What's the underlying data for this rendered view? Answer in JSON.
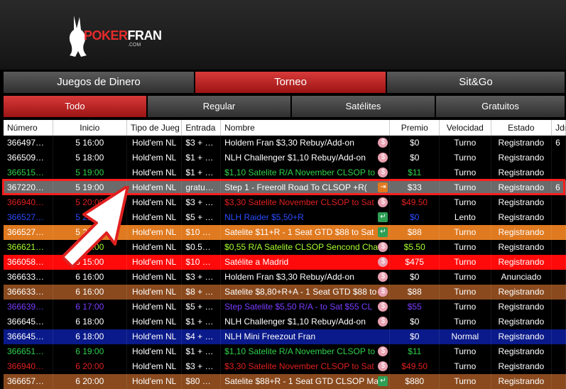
{
  "logo": {
    "text_poker": "POKER",
    "text_fran": "FRAN",
    "text_sub": ".COM"
  },
  "top_tabs": [
    {
      "label": "Juegos de Dinero",
      "active": false
    },
    {
      "label": "Torneo",
      "active": true
    },
    {
      "label": "Sit&Go",
      "active": false
    }
  ],
  "sub_tabs": [
    {
      "label": "Todo",
      "active": true
    },
    {
      "label": "Regular",
      "active": false
    },
    {
      "label": "Satélites",
      "active": false
    },
    {
      "label": "Gratuitos",
      "active": false
    }
  ],
  "columns": [
    "Número",
    "Inicio",
    "Tipo de Jueg",
    "Entrada",
    "Nombre",
    "Premio",
    "Velocidad",
    "Estado",
    "Jdr"
  ],
  "rows": [
    {
      "num": "366497…",
      "start": "5 16:00",
      "type": "Hold'em NL",
      "entry": "$3 + …",
      "name": "Holdem Fran $3,30 Rebuy/Add-on",
      "prize": "$0",
      "speed": "Turno",
      "status": "Registrando",
      "icon": "dollar-icon",
      "bg": "#000000",
      "fg": "#ffffff"
    },
    {
      "num": "366509…",
      "start": "5 18:00",
      "type": "Hold'em NL",
      "entry": "$1 + …",
      "name": "NLH Challenger $1,10 Rebuy/Add-on",
      "prize": "$0",
      "speed": "Turno",
      "status": "Registrando",
      "icon": "dollar-icon",
      "bg": "#000000",
      "fg": "#ffffff"
    },
    {
      "num": "366515…",
      "start": "5 19:00",
      "type": "Hold'em NL",
      "entry": "$1 + …",
      "name": "$1,10 Satelite R/A November CLSOP to",
      "prize": "$11",
      "speed": "Turno",
      "status": "Registrando",
      "icon": "dollar-icon",
      "bg": "#000000",
      "fg": "#2fd04a"
    },
    {
      "num": "367220…",
      "start": "5 19:00",
      "type": "Hold'em NL",
      "entry": "gratu…",
      "name": "Step 1 - Freeroll Road To CLSOP +R(",
      "prize": "$33",
      "speed": "Turno",
      "status": "Registrando",
      "icon": "enter-icon",
      "bg": "#6b6b6b",
      "fg": "#ffffff",
      "selected": true
    },
    {
      "num": "366940…",
      "start": "5 20:00",
      "type": "Hold'em NL",
      "entry": "$3 + …",
      "name": "$3,30 Satelite November CLSOP to Sat",
      "prize": "$49.50",
      "speed": "Turno",
      "status": "Registrando",
      "icon": "dollar-icon",
      "bg": "#000000",
      "fg": "#e02020"
    },
    {
      "num": "366527…",
      "start": "5 21:00",
      "type": "Hold'em NL",
      "entry": "$5 + …",
      "name": "NLH Raider $5,50+R",
      "prize": "$0",
      "speed": "Lento",
      "status": "Registrando",
      "icon": "return-icon",
      "bg": "#000000",
      "fg": "#2a4cff"
    },
    {
      "num": "366527…",
      "start": "5 21:00",
      "type": "Hold'em NL",
      "entry": "$10 …",
      "name": "Satelite $11+R - 1 Seat GTD $88  to Sat",
      "prize": "$88",
      "speed": "Turno",
      "status": "Registrando",
      "icon": "return-icon",
      "bg": "#e07a20",
      "fg": "#ffffff"
    },
    {
      "num": "366621…",
      "start": "5 22:00",
      "type": "Hold'em NL",
      "entry": "$0.5…",
      "name": "$0,55 R/A Satelite CLSOP Sencond Cha",
      "prize": "$5.50",
      "speed": "Turno",
      "status": "Registrando",
      "icon": "dollar-icon",
      "bg": "#000000",
      "fg": "#a8ff30"
    },
    {
      "num": "366058…",
      "start": "6 15:00",
      "type": "Hold'em NL",
      "entry": "$10 …",
      "name": "Satélite a Madrid",
      "prize": "$475",
      "speed": "Turno",
      "status": "Registrando",
      "icon": "dollar-icon",
      "bg": "#ff0a0a",
      "fg": "#ffffff"
    },
    {
      "num": "366633…",
      "start": "6 16:00",
      "type": "Hold'em NL",
      "entry": "$3 + …",
      "name": "Holdem Fran $3,30 Rebuy/Add-on",
      "prize": "$0",
      "speed": "Turno",
      "status": "Anunciado",
      "icon": "dollar-icon",
      "bg": "#000000",
      "fg": "#ffffff"
    },
    {
      "num": "366633…",
      "start": "6 16:00",
      "type": "Hold'em NL",
      "entry": "$8 + …",
      "name": "Satelite $8,80+R+A - 1 Seat GTD $88  to",
      "prize": "$88",
      "speed": "Turno",
      "status": "Registrando",
      "icon": "dollar-icon",
      "bg": "#8a4a1e",
      "fg": "#ffffff"
    },
    {
      "num": "366639…",
      "start": "6 17:00",
      "type": "Hold'em NL",
      "entry": "$5 + …",
      "name": "Step Satelite $5,50 R/A - to Sat $55 CL",
      "prize": "$55",
      "speed": "Turno",
      "status": "Registrando",
      "icon": "dollar-icon",
      "bg": "#000000",
      "fg": "#7a3cff"
    },
    {
      "num": "366645…",
      "start": "6 18:00",
      "type": "Hold'em NL",
      "entry": "$1 + …",
      "name": "NLH Challenger $1,10 Rebuy/Add-on",
      "prize": "$0",
      "speed": "Turno",
      "status": "Registrando",
      "icon": "dollar-icon",
      "bg": "#000000",
      "fg": "#ffffff"
    },
    {
      "num": "366645…",
      "start": "6 18:00",
      "type": "Hold'em NL",
      "entry": "$4 + …",
      "name": "NLH Mini Freezout Fran",
      "prize": "$0",
      "speed": "Normal",
      "status": "Registrando",
      "icon": "",
      "bg": "#0a1a8a",
      "fg": "#ffffff"
    },
    {
      "num": "366651…",
      "start": "6 19:00",
      "type": "Hold'em NL",
      "entry": "$1 + …",
      "name": "$1,10 Satelite R/A November CLSOP to",
      "prize": "$11",
      "speed": "Turno",
      "status": "Registrando",
      "icon": "dollar-icon",
      "bg": "#000000",
      "fg": "#2fd04a"
    },
    {
      "num": "366940…",
      "start": "6 20:00",
      "type": "Hold'em NL",
      "entry": "$3 + …",
      "name": "$3,30 Satelite November CLSOP to Sat",
      "prize": "$49.50",
      "speed": "Turno",
      "status": "Registrando",
      "icon": "dollar-icon",
      "bg": "#000000",
      "fg": "#e02020"
    },
    {
      "num": "366657…",
      "start": "6 20:00",
      "type": "Hold'em NL",
      "entry": "$80 …",
      "name": "Satelite $88+R - 1 Seat GTD CLSOP Mai",
      "prize": "$880",
      "speed": "Turno",
      "status": "Registrando",
      "icon": "return-icon",
      "bg": "#8a4a1e",
      "fg": "#ffffff"
    }
  ],
  "partial_col": [
    "6",
    "",
    "",
    "6",
    "",
    "",
    "",
    "",
    "",
    "",
    "",
    "",
    "",
    "",
    "",
    "",
    ""
  ]
}
